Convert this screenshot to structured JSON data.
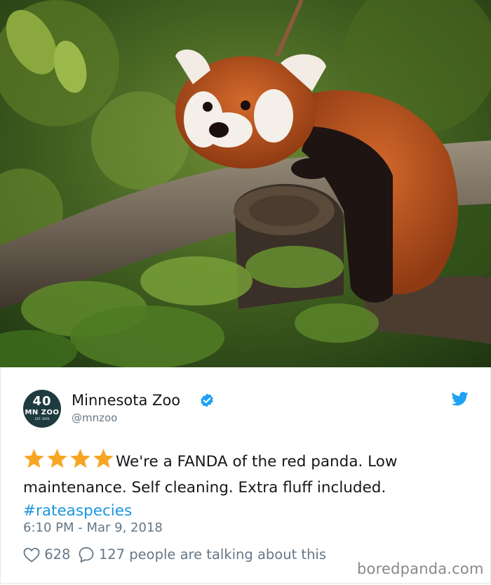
{
  "photo": {
    "subject": "red-panda-on-branch"
  },
  "account": {
    "avatar_number": "40",
    "avatar_line": "MN ZOO",
    "avatar_small": "EST. 1978",
    "name": "Minnesota Zoo",
    "handle": "@mnzoo",
    "verified": true
  },
  "tweet": {
    "stars": 4,
    "text": "We're a FANDA of the red panda. Low maintenance. Self cleaning. Extra fluff included.",
    "hashtag": "#rateaspecies",
    "timestamp": "6:10 PM - Mar 9, 2018",
    "likes": "628",
    "replies": "127",
    "talking": "people are talking about this"
  },
  "watermark": "boredpanda.com",
  "colors": {
    "twitter_blue": "#1da1f2",
    "hashtag_blue": "#1b95e0",
    "star_gold": "#f6a623",
    "muted_text": "#657786"
  },
  "icons": {
    "verified": "verified-badge-icon",
    "bird": "twitter-bird-icon",
    "like": "heart-outline-icon",
    "reply": "speech-bubble-icon",
    "star": "star-icon"
  }
}
